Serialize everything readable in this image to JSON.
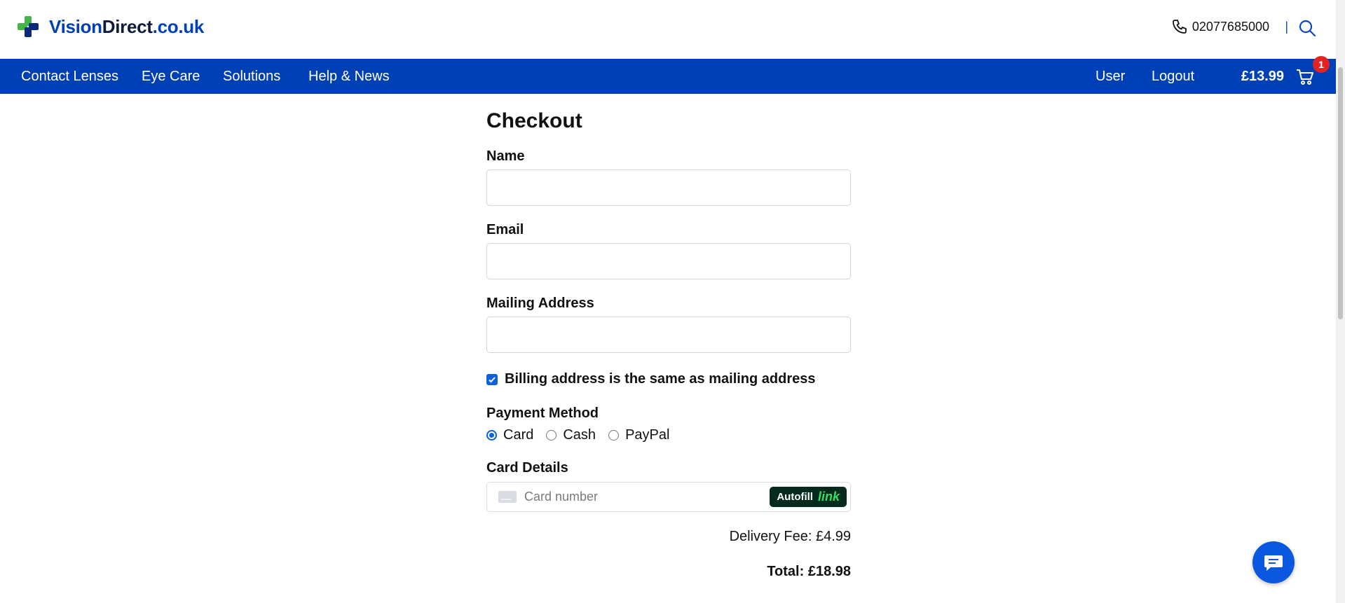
{
  "header": {
    "logo": {
      "vision": "Vision",
      "direct": "Direct",
      "tld": ".co.uk"
    },
    "phone": "02077685000",
    "divider": "|"
  },
  "nav": {
    "items": [
      "Contact Lenses",
      "Eye Care",
      "Solutions",
      "Help & News"
    ],
    "user": "User",
    "logout": "Logout",
    "cart_total": "£13.99",
    "cart_count": "1"
  },
  "checkout": {
    "title": "Checkout",
    "name_label": "Name",
    "name_value": "",
    "email_label": "Email",
    "email_value": "",
    "address_label": "Mailing Address",
    "address_value": "",
    "billing_same_label": "Billing address is the same as mailing address",
    "billing_same_checked": true,
    "payment_label": "Payment Method",
    "payment_options": [
      "Card",
      "Cash",
      "PayPal"
    ],
    "payment_selected": "Card",
    "card_details_label": "Card Details",
    "card_number_placeholder": "Card number",
    "autofill_label": "Autofill",
    "autofill_brand": "link",
    "delivery_fee": "Delivery Fee: £4.99",
    "total": "Total: £18.98"
  },
  "colors": {
    "brand_blue": "#0040b6",
    "accent_green": "#44b549",
    "badge_red": "#e02424",
    "chat_blue": "#0a57e0"
  },
  "icons": [
    "logo-cross-icon",
    "phone-icon",
    "search-icon",
    "cart-icon",
    "card-icon",
    "chat-icon"
  ]
}
